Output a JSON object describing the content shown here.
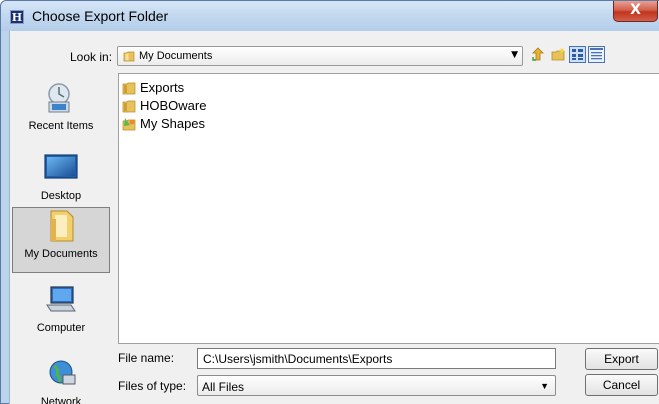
{
  "window": {
    "app_icon_letter": "H",
    "title": "Choose Export Folder",
    "close_label": "X"
  },
  "look_in": {
    "label": "Look in:",
    "value": "My Documents"
  },
  "toolbar": {
    "icons": [
      "up-one-level-icon",
      "create-new-folder-icon",
      "list-view-icon",
      "details-view-icon"
    ]
  },
  "places": [
    {
      "label": "Recent Items",
      "icon": "recent-items-icon"
    },
    {
      "label": "Desktop",
      "icon": "desktop-icon"
    },
    {
      "label": "My Documents",
      "icon": "my-documents-icon",
      "selected": true
    },
    {
      "label": "Computer",
      "icon": "computer-icon"
    },
    {
      "label": "Network",
      "icon": "network-icon"
    }
  ],
  "files": [
    {
      "name": "Exports",
      "icon": "folder-icon"
    },
    {
      "name": "HOBOware",
      "icon": "folder-icon"
    },
    {
      "name": "My Shapes",
      "icon": "shapes-folder-icon"
    }
  ],
  "file_name": {
    "label": "File name:",
    "value": "C:\\Users\\jsmith\\Documents\\Exports"
  },
  "file_type": {
    "label": "Files of type:",
    "value": "All Files"
  },
  "buttons": {
    "export": "Export",
    "cancel": "Cancel"
  },
  "colors": {
    "titlebar": "#c4d9f0",
    "close_button": "#c2341c",
    "folder": "#e8c15a",
    "dialog_bg": "#f0f0f0"
  }
}
